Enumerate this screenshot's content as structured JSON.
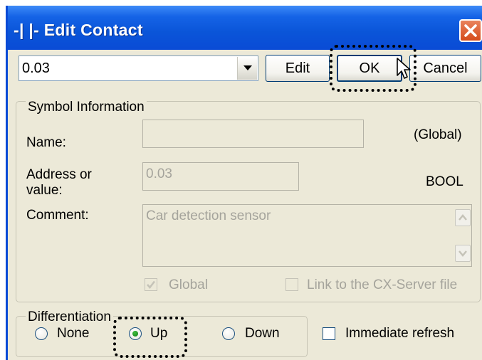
{
  "window": {
    "title": "-|  |- Edit Contact"
  },
  "toolbar": {
    "operand_value": "0.03",
    "edit_label": "Edit",
    "ok_label": "OK",
    "cancel_label": "Cancel"
  },
  "symbol_info": {
    "legend": "Symbol Information",
    "name_label": "Name:",
    "name_value": "",
    "scope": "(Global)",
    "address_label_line1": "Address or",
    "address_label_line2": "value:",
    "address_value": "0.03",
    "data_type": "BOOL",
    "comment_label": "Comment:",
    "comment_value": "Car detection sensor",
    "global_label": "Global",
    "global_checked": true,
    "link_label": "Link to the CX-Server file",
    "link_checked": false
  },
  "differentiation": {
    "legend": "Differentiation",
    "options": [
      "None",
      "Up",
      "Down"
    ],
    "selected": "Up"
  },
  "immediate_refresh": {
    "label": "Immediate refresh",
    "checked": false
  },
  "icons": [
    "close-icon",
    "dropdown-arrow-icon",
    "mouse-cursor-icon",
    "scroll-up-icon",
    "scroll-down-icon",
    "checkmark-icon"
  ]
}
